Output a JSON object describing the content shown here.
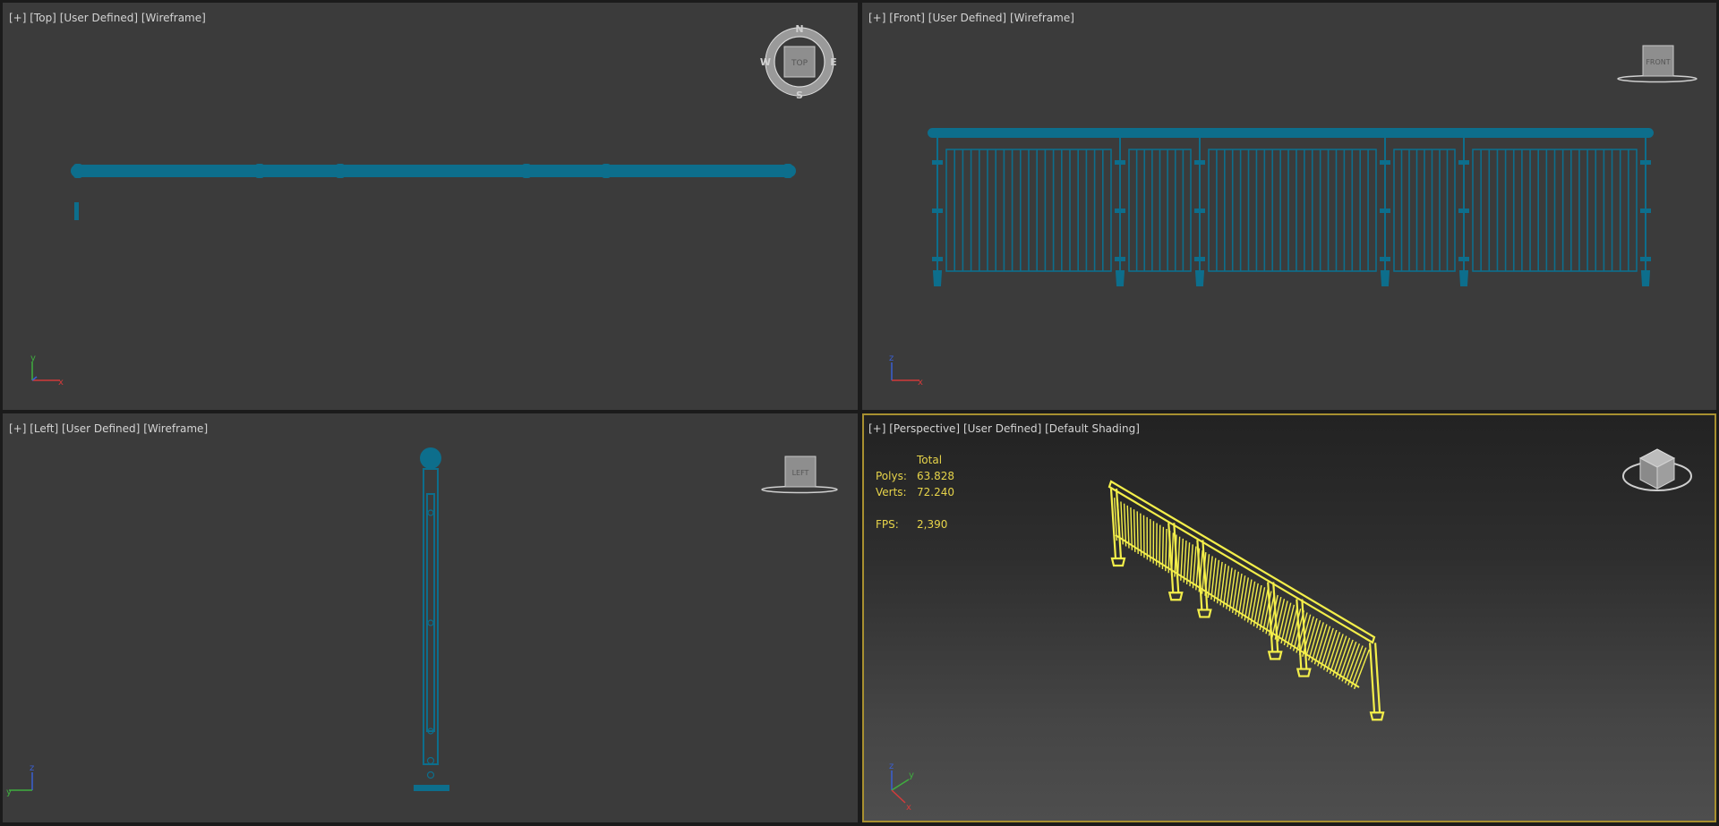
{
  "viewports": {
    "top": {
      "menu": "[+]",
      "view": "[Top]",
      "camera": "[User Defined]",
      "shading": "[Wireframe]",
      "viewcube": {
        "face": "TOP",
        "compass": {
          "n": "N",
          "s": "S",
          "e": "E",
          "w": "W"
        }
      },
      "axis": {
        "up": "y",
        "right": "x"
      }
    },
    "front": {
      "menu": "[+]",
      "view": "[Front]",
      "camera": "[User Defined]",
      "shading": "[Wireframe]",
      "viewcube": {
        "face": "FRONT"
      },
      "axis": {
        "up": "z",
        "right": "x"
      }
    },
    "left": {
      "menu": "[+]",
      "view": "[Left]",
      "camera": "[User Defined]",
      "shading": "[Wireframe]",
      "viewcube": {
        "face": "LEFT"
      },
      "axis": {
        "up": "z",
        "right": "y"
      }
    },
    "perspective": {
      "menu": "[+]",
      "view": "[Perspective]",
      "camera": "[User Defined]",
      "shading": "[Default Shading]",
      "active": true,
      "stats": {
        "header": "Total",
        "polys_label": "Polys:",
        "polys": "63.828",
        "verts_label": "Verts:",
        "verts": "72.240",
        "fps_label": "FPS:",
        "fps": "2,390"
      },
      "axis": {
        "up": "z",
        "a": "y",
        "b": "x"
      }
    }
  },
  "colors": {
    "wireframe": "#0d6e8c",
    "selected": "#f3ee4a",
    "viewport_bg": "#3b3b3b",
    "active_border": "#a89030"
  }
}
